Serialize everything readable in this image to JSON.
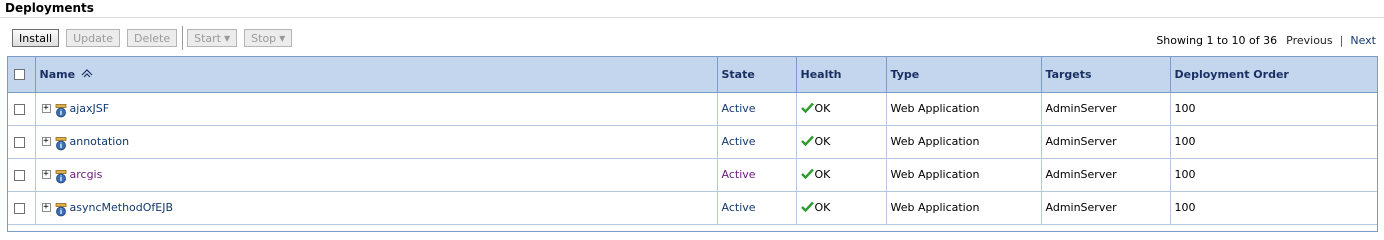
{
  "page": {
    "title": "Deployments"
  },
  "toolbar": {
    "install_label": "Install",
    "update_label": "Update",
    "delete_label": "Delete",
    "start_label": "Start",
    "stop_label": "Stop"
  },
  "pager": {
    "showing_text": "Showing 1 to 10 of 36",
    "previous_label": "Previous",
    "separator": "|",
    "next_label": "Next"
  },
  "table": {
    "columns": [
      "Name",
      "State",
      "Health",
      "Type",
      "Targets",
      "Deployment Order"
    ],
    "rows": [
      {
        "name": "ajaxJSF",
        "state": "Active",
        "health": "OK",
        "type": "Web Application",
        "targets": "AdminServer",
        "order": "100"
      },
      {
        "name": "annotation",
        "state": "Active",
        "health": "OK",
        "type": "Web Application",
        "targets": "AdminServer",
        "order": "100"
      },
      {
        "name": "arcgis",
        "state": "Active",
        "health": "OK",
        "type": "Web Application",
        "targets": "AdminServer",
        "order": "100"
      },
      {
        "name": "asyncMethodOfEJB",
        "state": "Active",
        "health": "OK",
        "type": "Web Application",
        "targets": "AdminServer",
        "order": "100"
      }
    ]
  },
  "colors": {
    "header_bg": "#c4d6ee",
    "header_text": "#1a3063",
    "border": "#7c9bc7",
    "link": "#13396e",
    "visited_link": "#6a1a7a",
    "ok_green": "#2e9b2e"
  }
}
